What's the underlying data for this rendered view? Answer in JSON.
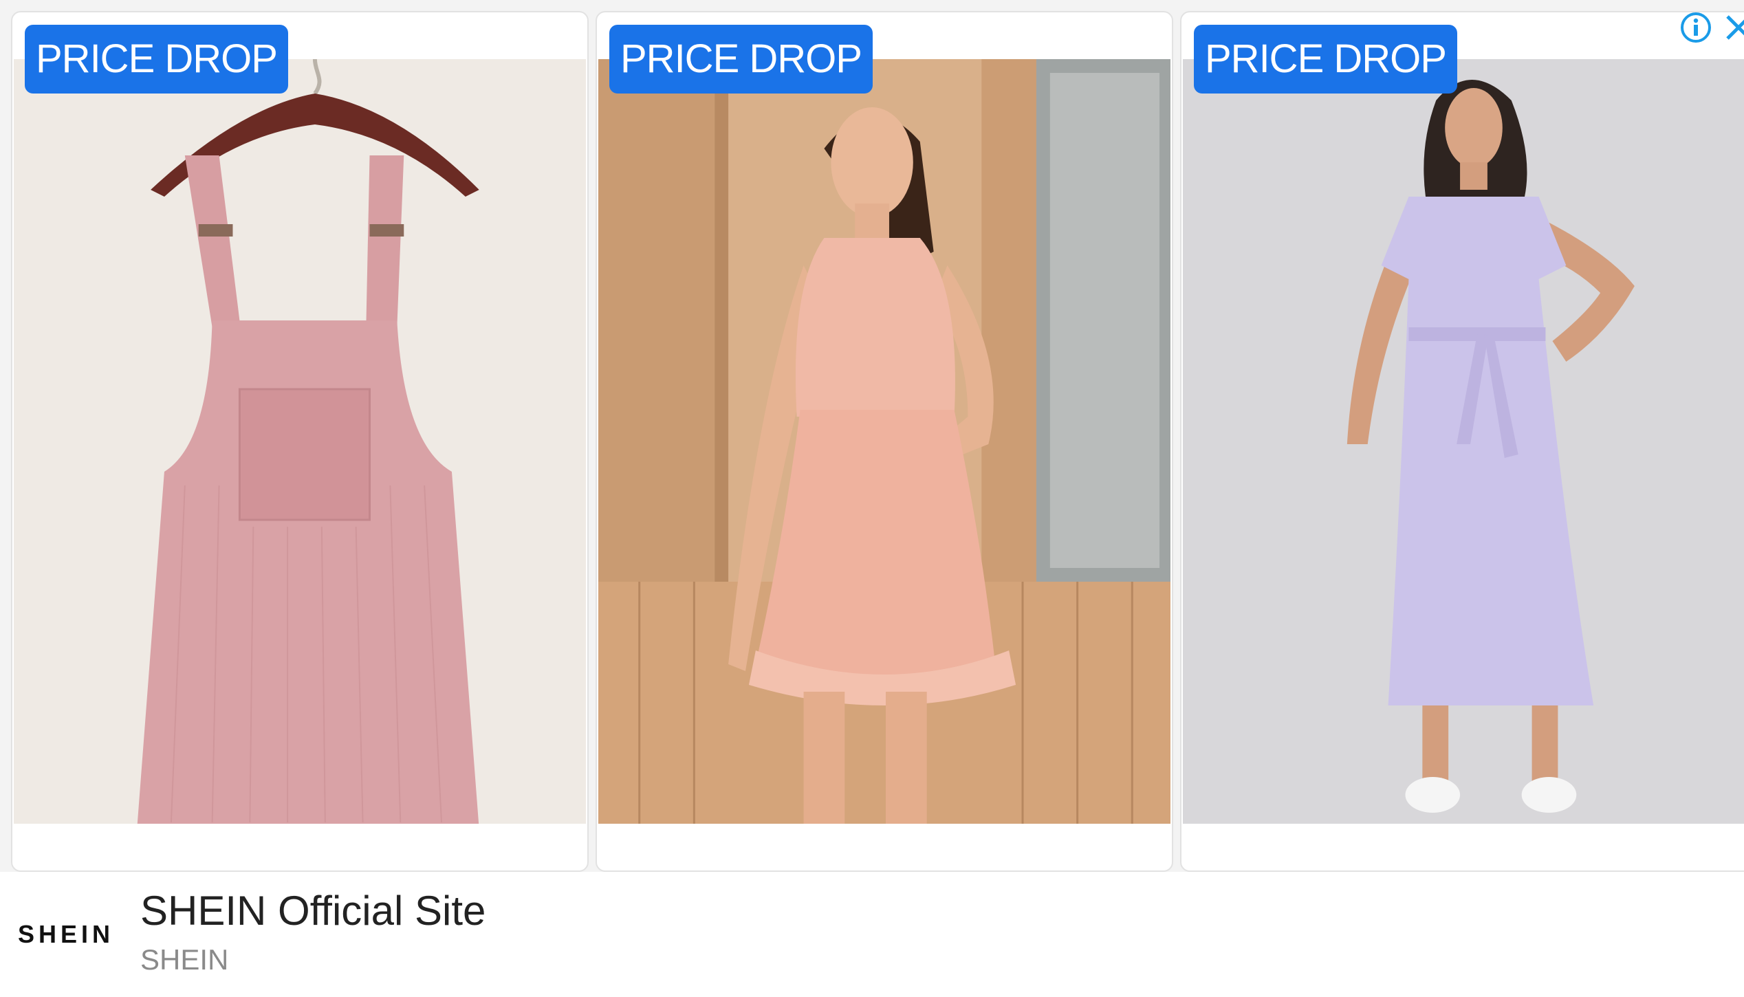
{
  "ad": {
    "cards": [
      {
        "badge": "PRICE DROP",
        "product_icon": "pinafore-dress-image",
        "colors": {
          "bg": "#efeae4",
          "garment": "#d9a2a6"
        }
      },
      {
        "badge": "PRICE DROP",
        "product_icon": "halter-dress-model-image",
        "colors": {
          "bg": "#d9b08a",
          "garment": "#f0b9a6"
        }
      },
      {
        "badge": "PRICE DROP",
        "product_icon": "lilac-dress-model-image",
        "colors": {
          "bg": "#d8d7da",
          "garment": "#cbc3ea"
        }
      }
    ],
    "badge_color": "#1a73e8",
    "footer": {
      "brand_logo": "SHEIN",
      "headline": "SHEIN Official Site",
      "advertiser": "SHEIN"
    },
    "adchoices": {
      "info_icon": "info-icon",
      "close_icon": "close-icon",
      "color": "#1a9be8"
    }
  }
}
